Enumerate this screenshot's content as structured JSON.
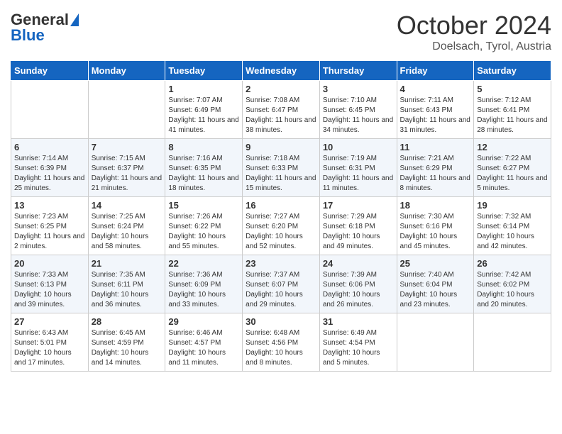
{
  "header": {
    "logo_line1": "General",
    "logo_line2": "Blue",
    "month": "October 2024",
    "location": "Doelsach, Tyrol, Austria"
  },
  "days_of_week": [
    "Sunday",
    "Monday",
    "Tuesday",
    "Wednesday",
    "Thursday",
    "Friday",
    "Saturday"
  ],
  "weeks": [
    [
      {
        "num": "",
        "info": ""
      },
      {
        "num": "",
        "info": ""
      },
      {
        "num": "1",
        "info": "Sunrise: 7:07 AM\nSunset: 6:49 PM\nDaylight: 11 hours and 41 minutes."
      },
      {
        "num": "2",
        "info": "Sunrise: 7:08 AM\nSunset: 6:47 PM\nDaylight: 11 hours and 38 minutes."
      },
      {
        "num": "3",
        "info": "Sunrise: 7:10 AM\nSunset: 6:45 PM\nDaylight: 11 hours and 34 minutes."
      },
      {
        "num": "4",
        "info": "Sunrise: 7:11 AM\nSunset: 6:43 PM\nDaylight: 11 hours and 31 minutes."
      },
      {
        "num": "5",
        "info": "Sunrise: 7:12 AM\nSunset: 6:41 PM\nDaylight: 11 hours and 28 minutes."
      }
    ],
    [
      {
        "num": "6",
        "info": "Sunrise: 7:14 AM\nSunset: 6:39 PM\nDaylight: 11 hours and 25 minutes."
      },
      {
        "num": "7",
        "info": "Sunrise: 7:15 AM\nSunset: 6:37 PM\nDaylight: 11 hours and 21 minutes."
      },
      {
        "num": "8",
        "info": "Sunrise: 7:16 AM\nSunset: 6:35 PM\nDaylight: 11 hours and 18 minutes."
      },
      {
        "num": "9",
        "info": "Sunrise: 7:18 AM\nSunset: 6:33 PM\nDaylight: 11 hours and 15 minutes."
      },
      {
        "num": "10",
        "info": "Sunrise: 7:19 AM\nSunset: 6:31 PM\nDaylight: 11 hours and 11 minutes."
      },
      {
        "num": "11",
        "info": "Sunrise: 7:21 AM\nSunset: 6:29 PM\nDaylight: 11 hours and 8 minutes."
      },
      {
        "num": "12",
        "info": "Sunrise: 7:22 AM\nSunset: 6:27 PM\nDaylight: 11 hours and 5 minutes."
      }
    ],
    [
      {
        "num": "13",
        "info": "Sunrise: 7:23 AM\nSunset: 6:25 PM\nDaylight: 11 hours and 2 minutes."
      },
      {
        "num": "14",
        "info": "Sunrise: 7:25 AM\nSunset: 6:24 PM\nDaylight: 10 hours and 58 minutes."
      },
      {
        "num": "15",
        "info": "Sunrise: 7:26 AM\nSunset: 6:22 PM\nDaylight: 10 hours and 55 minutes."
      },
      {
        "num": "16",
        "info": "Sunrise: 7:27 AM\nSunset: 6:20 PM\nDaylight: 10 hours and 52 minutes."
      },
      {
        "num": "17",
        "info": "Sunrise: 7:29 AM\nSunset: 6:18 PM\nDaylight: 10 hours and 49 minutes."
      },
      {
        "num": "18",
        "info": "Sunrise: 7:30 AM\nSunset: 6:16 PM\nDaylight: 10 hours and 45 minutes."
      },
      {
        "num": "19",
        "info": "Sunrise: 7:32 AM\nSunset: 6:14 PM\nDaylight: 10 hours and 42 minutes."
      }
    ],
    [
      {
        "num": "20",
        "info": "Sunrise: 7:33 AM\nSunset: 6:13 PM\nDaylight: 10 hours and 39 minutes."
      },
      {
        "num": "21",
        "info": "Sunrise: 7:35 AM\nSunset: 6:11 PM\nDaylight: 10 hours and 36 minutes."
      },
      {
        "num": "22",
        "info": "Sunrise: 7:36 AM\nSunset: 6:09 PM\nDaylight: 10 hours and 33 minutes."
      },
      {
        "num": "23",
        "info": "Sunrise: 7:37 AM\nSunset: 6:07 PM\nDaylight: 10 hours and 29 minutes."
      },
      {
        "num": "24",
        "info": "Sunrise: 7:39 AM\nSunset: 6:06 PM\nDaylight: 10 hours and 26 minutes."
      },
      {
        "num": "25",
        "info": "Sunrise: 7:40 AM\nSunset: 6:04 PM\nDaylight: 10 hours and 23 minutes."
      },
      {
        "num": "26",
        "info": "Sunrise: 7:42 AM\nSunset: 6:02 PM\nDaylight: 10 hours and 20 minutes."
      }
    ],
    [
      {
        "num": "27",
        "info": "Sunrise: 6:43 AM\nSunset: 5:01 PM\nDaylight: 10 hours and 17 minutes."
      },
      {
        "num": "28",
        "info": "Sunrise: 6:45 AM\nSunset: 4:59 PM\nDaylight: 10 hours and 14 minutes."
      },
      {
        "num": "29",
        "info": "Sunrise: 6:46 AM\nSunset: 4:57 PM\nDaylight: 10 hours and 11 minutes."
      },
      {
        "num": "30",
        "info": "Sunrise: 6:48 AM\nSunset: 4:56 PM\nDaylight: 10 hours and 8 minutes."
      },
      {
        "num": "31",
        "info": "Sunrise: 6:49 AM\nSunset: 4:54 PM\nDaylight: 10 hours and 5 minutes."
      },
      {
        "num": "",
        "info": ""
      },
      {
        "num": "",
        "info": ""
      }
    ]
  ]
}
